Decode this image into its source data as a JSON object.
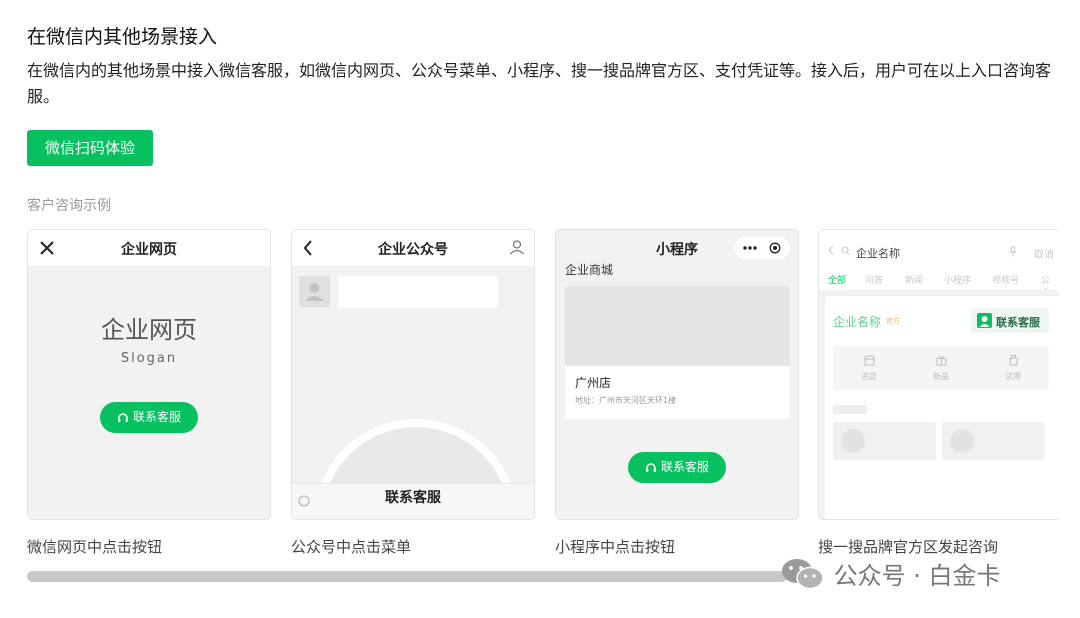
{
  "header": {
    "title": "在微信内其他场景接入",
    "description": "在微信内的其他场景中接入微信客服，如微信内网页、公众号菜单、小程序、搜一搜品牌官方区、支付凭证等。接入后，用户可在以上入口咨询客服。",
    "cta_label": "微信扫码体验"
  },
  "section_label": "客户咨询示例",
  "cards": {
    "web": {
      "title": "企业网页",
      "hero": "企业网页",
      "slogan": "Slogan",
      "button": "联系客服",
      "caption": "微信网页中点击按钮"
    },
    "oa": {
      "title": "企业公众号",
      "menu_label": "联系客服",
      "caption": "公众号中点击菜单"
    },
    "mini": {
      "title": "小程序",
      "mall": "企业商城",
      "store": "广州店",
      "address": "地址：广州市天河区天环1楼",
      "button": "联系客服",
      "caption": "小程序中点击按钮"
    },
    "search": {
      "query": "企业名称",
      "cancel": "取消",
      "tabs": [
        "全部",
        "问答",
        "新闻",
        "小程序",
        "视频号",
        "公众"
      ],
      "brand": "企业名称",
      "brand_tag": "官方",
      "contact": "联系客服",
      "actions": [
        "进店",
        "新品",
        "试用"
      ],
      "caption": "搜一搜品牌官方区发起咨询"
    }
  },
  "watermark": {
    "text": "公众号 · 白金卡"
  },
  "colors": {
    "accent": "#07c160",
    "scrollbar": "#c9c9c9"
  }
}
